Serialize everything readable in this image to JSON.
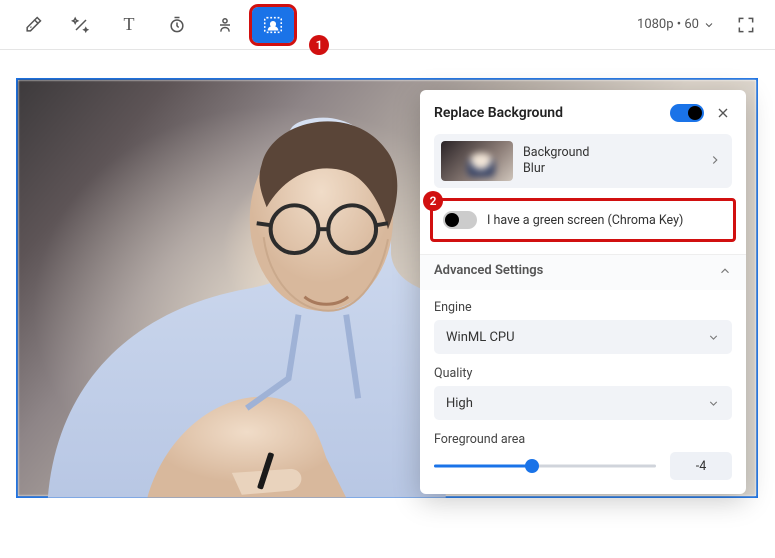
{
  "toolbar": {
    "output_label": "1080p • 60",
    "tools": [
      {
        "name": "color-picker"
      },
      {
        "name": "magic-wand"
      },
      {
        "name": "text"
      },
      {
        "name": "timer"
      },
      {
        "name": "presenter"
      },
      {
        "name": "background-replace",
        "active": true
      }
    ]
  },
  "annotations": {
    "badge1": "1",
    "badge2": "2"
  },
  "panel": {
    "title": "Replace Background",
    "bg_option": {
      "line1": "Background",
      "line2": "Blur"
    },
    "chroma_label": "I have a green screen (Chroma Key)",
    "advanced_title": "Advanced Settings",
    "engine": {
      "label": "Engine",
      "value": "WinML CPU"
    },
    "quality": {
      "label": "Quality",
      "value": "High"
    },
    "foreground": {
      "label": "Foreground area",
      "value": "-4"
    }
  }
}
